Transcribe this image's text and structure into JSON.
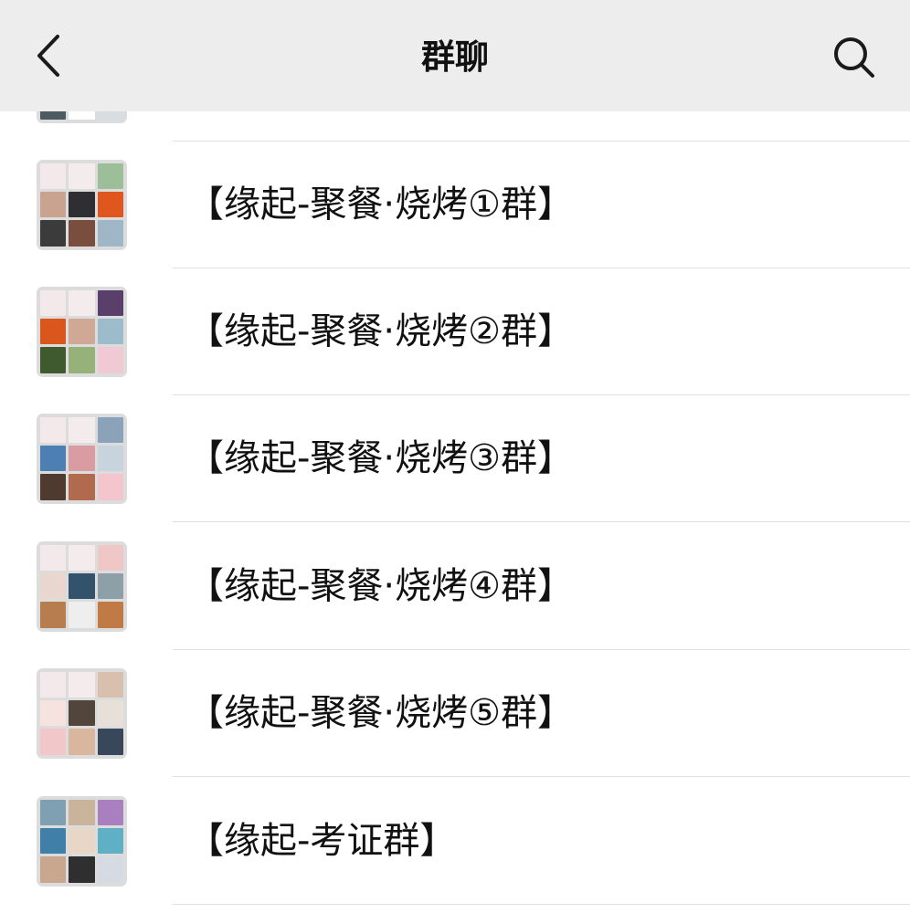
{
  "header": {
    "title": "群聊",
    "back_icon": "chevron-left-icon",
    "search_icon": "search-icon"
  },
  "groups": [
    {
      "name": "",
      "tiles": [
        "#3b4a5c",
        "#cfd3d8",
        "#f1f1f1",
        "#6b7b6a",
        "#e9e9e9",
        "#c8c8c8",
        "#4d5a62",
        "#ffffff",
        "#d8dde2"
      ]
    },
    {
      "name": "【缘起-聚餐·烧烤①群】",
      "tiles": [
        "#f3e9ea",
        "#f4ecec",
        "#9cbf9a",
        "#c9a38f",
        "#2e2e33",
        "#e0561f",
        "#3b3b3b",
        "#7a4e3f",
        "#9fb6c7"
      ]
    },
    {
      "name": "【缘起-聚餐·烧烤②群】",
      "tiles": [
        "#f3e9ea",
        "#f4ecec",
        "#5a3f6a",
        "#d9561c",
        "#cfa995",
        "#9dbccb",
        "#3e5a2e",
        "#96b17a",
        "#f1c9d4"
      ]
    },
    {
      "name": "【缘起-聚餐·烧烤③群】",
      "tiles": [
        "#f3e9ea",
        "#f4ecec",
        "#8aa3b8",
        "#4d7fb2",
        "#d99ca3",
        "#c7d3dd",
        "#4f3a2f",
        "#b26a4f",
        "#f4c5cc"
      ]
    },
    {
      "name": "【缘起-聚餐·烧烤④群】",
      "tiles": [
        "#f3e9ea",
        "#f4ecec",
        "#f0c7c7",
        "#e8d6cf",
        "#33526b",
        "#8da0a8",
        "#b77d4e",
        "#eeeeee",
        "#c07a45"
      ]
    },
    {
      "name": "【缘起-聚餐·烧烤⑤群】",
      "tiles": [
        "#f3e9ea",
        "#f4ecec",
        "#d9bfae",
        "#f6e2df",
        "#52463c",
        "#e7e0d8",
        "#f2c7c9",
        "#d9b79f",
        "#39475a"
      ]
    },
    {
      "name": "【缘起-考证群】",
      "tiles": [
        "#7f9fb3",
        "#c9b39a",
        "#a97fbf",
        "#3f7fa8",
        "#e8d6c6",
        "#5fb0c4",
        "#c9a68e",
        "#2f2f2f",
        "#d6dbe3"
      ]
    }
  ]
}
